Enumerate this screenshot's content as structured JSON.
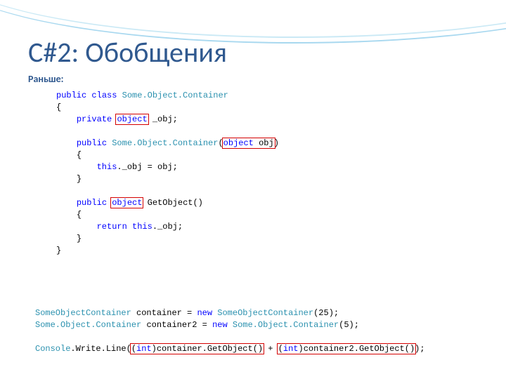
{
  "title": "C#2: Обобщения",
  "subtitle": "Раньше:",
  "code": {
    "kw_public": "public",
    "kw_class": "class",
    "kw_private": "private",
    "kw_this": "this",
    "kw_return": "return",
    "kw_new": "new",
    "kw_object": "object",
    "kw_int": "int",
    "ty_container": "Some.Object.Container",
    "ty_container_nodot": "SomeObjectContainer",
    "ty_console": "Console",
    "m_write": "Write.Line",
    "m_getobj": "GetObject",
    "f_obj": "_obj",
    "p_obj": "obj",
    "v_c1": "container",
    "v_c2": "container2",
    "n25": "25",
    "n5": "5",
    "brace_o": "{",
    "brace_c": "}",
    "assign_obj": "._obj = obj;",
    "ret_obj": "._obj;",
    "sep_plus": " + "
  }
}
